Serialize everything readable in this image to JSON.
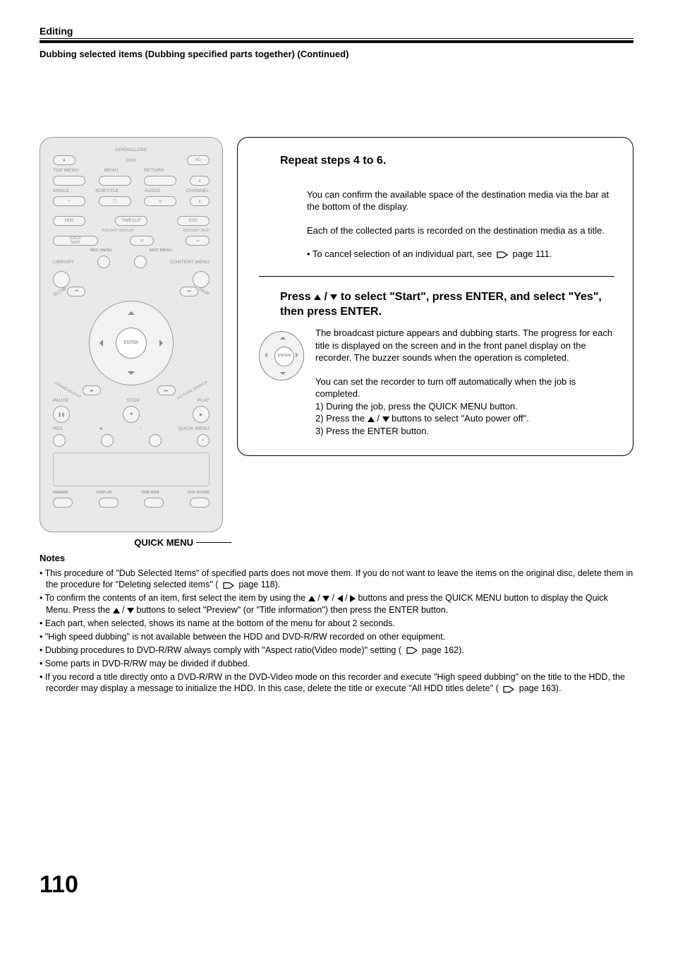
{
  "header": {
    "section": "Editing",
    "subtitle": "Dubbing selected items (Dubbing specified parts together) (Continued)"
  },
  "remote": {
    "open_close": "OPEN/CLOSE",
    "power": "I/⏻",
    "dvd": "DVD",
    "top_menu": "TOP MENU",
    "menu": "MENU",
    "return": "RETURN",
    "angle": "ANGLE",
    "subtitle": "SUBTITLE",
    "audio": "AUDIO",
    "channel": "CHANNEL",
    "hdd": "HDD",
    "timeslip": "TIMESLIP",
    "dvd2": "DVD",
    "instant_replay": "INSTANT REPLAY",
    "instant_skip": "INSTANT SKIP",
    "easy_navi": "EASY\nNAVI",
    "rec_menu": "REC MENU",
    "edit_menu": "EDIT MENU",
    "library": "LIBRARY",
    "content_menu": "CONTENT MENU",
    "enter": "ENTER",
    "slow": "SLOW",
    "skip": "SKIP",
    "frame_adjust": "FRAME/ADJUST",
    "picture_search": "PICTURE SEARCH",
    "pause": "PAUSE",
    "stop": "STOP",
    "play": "PLAY",
    "rec": "REC",
    "quick_menu_btn": "QUICK MENU",
    "remain": "REMAIN",
    "display": "DISPLAY",
    "time_bar": "TIME BAR",
    "chp_divide": "CHP DIVIDE",
    "quick_menu_label": "QUICK MENU"
  },
  "step7": {
    "title": "Repeat steps 4 to 6.",
    "p1": "You can confirm the available space of the destination media via the bar at the bottom of the display.",
    "p2": "Each of the collected parts is recorded on the destination media as a title.",
    "bullet_prefix": "• To cancel selection of an individual part, see ",
    "bullet_page": " page 111."
  },
  "step8": {
    "title_a": "Press ",
    "title_b": " / ",
    "title_c": " to select \"Start\", press ENTER, and select \"Yes\", then press ENTER.",
    "enter": "ENTER",
    "p1": "The broadcast picture appears and dubbing starts. The progress for each title is displayed on the screen and in the front panel display on the recorder. The buzzer sounds when the operation is completed.",
    "p2": "You can set the recorder to turn off automatically when the job is completed.",
    "l1": "1)  During the job, press the QUICK MENU button.",
    "l2a": "2)  Press the ",
    "l2b": " / ",
    "l2c": " buttons to select \"Auto power off\".",
    "l3": "3)  Press the ENTER button."
  },
  "notes": {
    "heading": "Notes",
    "n1a": "This procedure of \"Dub Selected Items\" of specified parts does not move them. If you do not want to leave the items on the original disc, delete them in the procedure for \"Deleting selected items\" (",
    "n1b": " page 118).",
    "n2a": "To confirm the contents of an item, first select the item by using the ",
    "n2b": " / ",
    "n2c": " / ",
    "n2d": " / ",
    "n2e": " buttons and press the QUICK MENU button to display the Quick Menu. Press the ",
    "n2f": " / ",
    "n2g": " buttons to select \"Preview\" (or \"Title information\") then press the ENTER button.",
    "n3": "Each part, when selected, shows its name at the bottom of the menu for about 2 seconds.",
    "n4": "\"High speed dubbing\" is not available between the HDD and DVD-R/RW recorded on other equipment.",
    "n5a": "Dubbing procedures to DVD-R/RW always comply with \"Aspect ratio(Video mode)\" setting (",
    "n5b": " page 162).",
    "n6": "Some parts in DVD-R/RW may be divided if dubbed.",
    "n7a": "If you record a title directly onto a DVD-R/RW in the DVD-Video mode on this recorder and execute \"High speed dubbing\" on the title to the HDD, the recorder may display a message to initialize the HDD. In this case, delete the title or execute \"All HDD titles delete\" (",
    "n7b": " page 163)."
  },
  "page_number": "110"
}
